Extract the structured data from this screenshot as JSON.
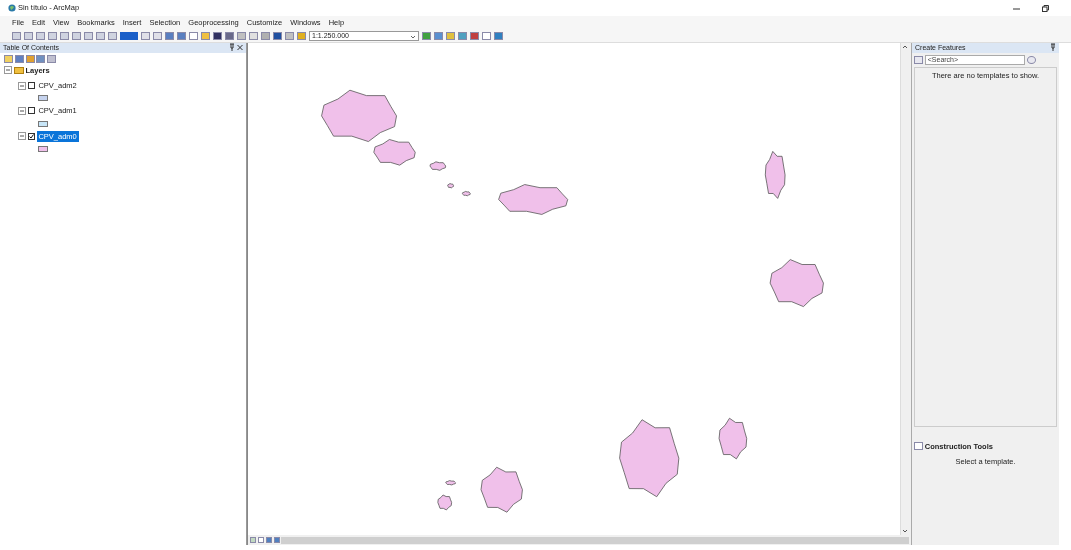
{
  "window": {
    "title": "Sin título - ArcMap"
  },
  "menu": [
    "File",
    "Edit",
    "View",
    "Bookmarks",
    "Insert",
    "Selection",
    "Geoprocessing",
    "Customize",
    "Windows",
    "Help"
  ],
  "toolbar": {
    "scale": "1:1.250.000"
  },
  "toc": {
    "title": "Table Of Contents",
    "root": {
      "label": "Layers",
      "expanded": true,
      "children": [
        {
          "label": "CPV_adm2",
          "checked": false,
          "selected": false,
          "expanded": true,
          "color": "#c6d3ee"
        },
        {
          "label": "CPV_adm1",
          "checked": false,
          "selected": false,
          "expanded": true,
          "color": "#c8e6f8"
        },
        {
          "label": "CPV_adm0",
          "checked": true,
          "selected": true,
          "expanded": true,
          "color": "#f0c0ea"
        }
      ]
    }
  },
  "create_features": {
    "title": "Create Features",
    "search": {
      "placeholder": "<Search>"
    },
    "message": "There are no templates to show."
  },
  "construction_tools": {
    "title": "Construction Tools",
    "message": "Select a template."
  }
}
